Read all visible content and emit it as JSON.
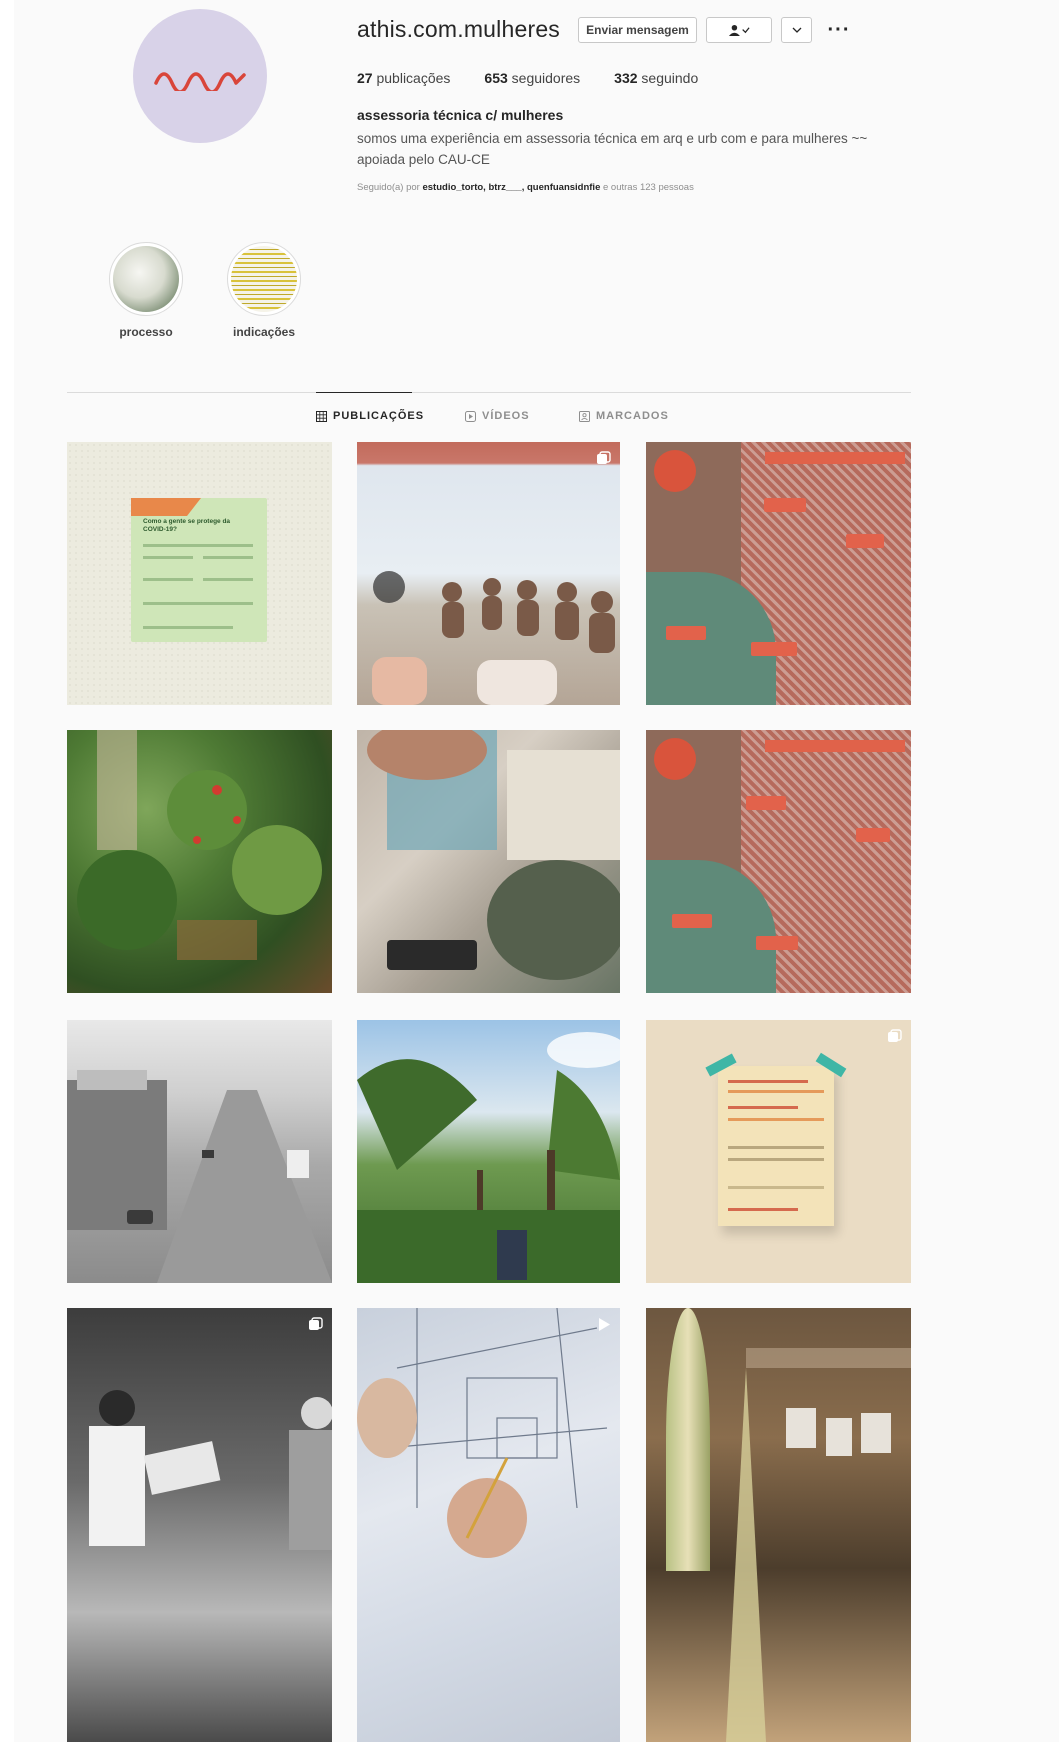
{
  "profile": {
    "username": "athis.com.mulheres",
    "message_button": "Enviar mensagem",
    "more_label": "···",
    "stats": {
      "posts_count": "27",
      "posts_label": "publicações",
      "followers_count": "653",
      "followers_label": "seguidores",
      "following_count": "332",
      "following_label": "seguindo"
    },
    "bio_name": "assessoria técnica c/ mulheres",
    "bio_text": "somos uma experiência em assessoria técnica em arq e urb com e para mulheres ~~ apoiada pelo CAU-CE",
    "followed_prefix": "Seguido(a) por ",
    "followed_users": "estudio_torto, btrz___, quenfuansidnfie",
    "followed_suffix": " e outras 123 pessoas"
  },
  "highlights": [
    {
      "label": "processo"
    },
    {
      "label": "indicações"
    }
  ],
  "tabs": [
    {
      "label": "PUBLICAÇÕES",
      "active": true
    },
    {
      "label": "VÍDEOS",
      "active": false
    },
    {
      "label": "MARCADOS",
      "active": false
    }
  ],
  "posts": [
    {
      "label": "Como a gente se protege da COVID-19?",
      "multi": false
    },
    {
      "label": "meeting",
      "multi": true
    },
    {
      "label": "map",
      "multi": false
    },
    {
      "label": "garden",
      "multi": false
    },
    {
      "label": "hands",
      "multi": false
    },
    {
      "label": "map-2",
      "multi": false
    },
    {
      "label": "street",
      "multi": false
    },
    {
      "label": "banana-trees",
      "multi": false
    },
    {
      "label": "poster",
      "multi": true
    },
    {
      "label": "people",
      "multi": true
    },
    {
      "label": "plan",
      "multi": true
    },
    {
      "label": "plant",
      "multi": false
    }
  ],
  "colors": {
    "accent_wave": "#d9453a",
    "avatar_bg": "#d8d2e8",
    "text_primary": "#262626",
    "text_secondary": "#8e8e8e"
  }
}
